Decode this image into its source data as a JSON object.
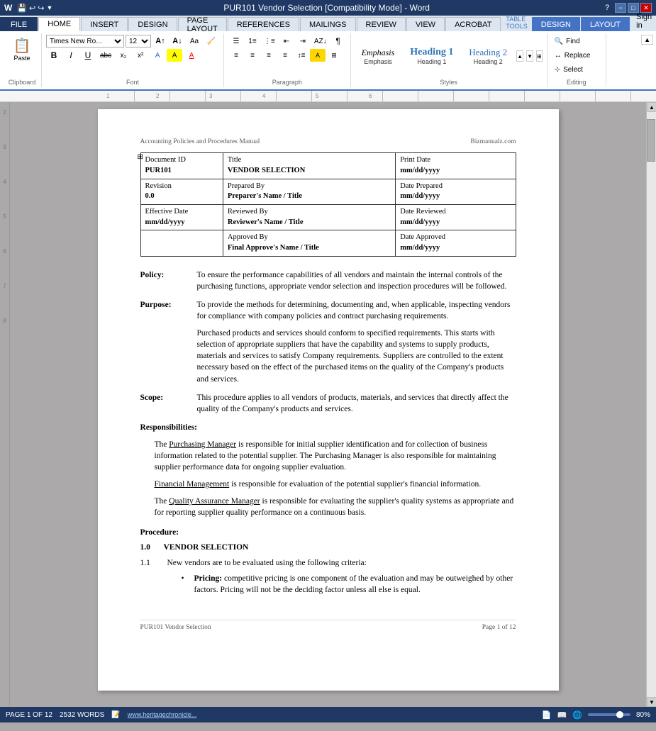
{
  "titleBar": {
    "title": "PUR101 Vendor Selection [Compatibility Mode] - Word",
    "tableTools": "TABLE TOOLS",
    "help": "?",
    "minimize": "−",
    "maximize": "□",
    "close": "✕"
  },
  "tabs": {
    "file": "FILE",
    "home": "HOME",
    "insert": "INSERT",
    "design": "DESIGN",
    "pageLayout": "PAGE LAYOUT",
    "references": "REFERENCES",
    "mailings": "MAILINGS",
    "review": "REVIEW",
    "view": "VIEW",
    "acrobat": "ACROBAT",
    "tableDesign": "DESIGN",
    "tableLayout": "LAYOUT",
    "signIn": "Sign in"
  },
  "ribbon": {
    "clipboard": {
      "label": "Clipboard",
      "paste": "Paste"
    },
    "font": {
      "label": "Font",
      "fontName": "Times New Ro...",
      "fontSize": "12",
      "bold": "B",
      "italic": "I",
      "underline": "U",
      "strikethrough": "abc",
      "subscript": "x₂",
      "superscript": "x²",
      "textColor": "A",
      "highlight": "A"
    },
    "paragraph": {
      "label": "Paragraph"
    },
    "styles": {
      "label": "Styles",
      "emphasis": "Emphasis",
      "heading1": "Heading 1",
      "heading2": "Heading 2"
    },
    "editing": {
      "label": "Editing",
      "find": "Find",
      "replace": "Replace",
      "select": "Select"
    }
  },
  "document": {
    "header": {
      "left": "Accounting Policies and Procedures Manual",
      "right": "Bizmanualz.com"
    },
    "table": {
      "rows": [
        [
          "Document ID\nPUR101",
          "Title\nVENDOR SELECTION",
          "Print Date\nmm/dd/yyyy"
        ],
        [
          "Revision\n0.0",
          "Prepared By\nPreparer's Name / Title",
          "Date Prepared\nmm/dd/yyyy"
        ],
        [
          "Effective Date\nmm/dd/yyyy",
          "Reviewed By\nReviewer's Name / Title",
          "Date Reviewed\nmm/dd/yyyy"
        ],
        [
          "",
          "Approved By\nFinal Approve's Name / Title",
          "Date Approved\nmm/dd/yyyy"
        ]
      ]
    },
    "policy": {
      "label": "Policy:",
      "text": "To ensure the performance capabilities of all vendors and maintain the internal controls of the purchasing functions, appropriate vendor selection and inspection procedures will be followed."
    },
    "purpose": {
      "label": "Purpose:",
      "text1": "To provide the methods for determining, documenting and, when applicable, inspecting vendors for compliance with company policies and contract purchasing requirements.",
      "text2": "Purchased products and services should conform to specified requirements.  This starts with selection of appropriate suppliers that have the capability and systems to supply products, materials and services to satisfy Company requirements.  Suppliers are controlled to the extent necessary based on the effect of the purchased items on the quality of the Company's products and services."
    },
    "scope": {
      "label": "Scope:",
      "text": "This procedure applies to all vendors of products, materials, and services that directly affect the quality of the Company's products and services."
    },
    "responsibilities": {
      "header": "Responsibilities:",
      "items": [
        {
          "manager": "Purchasing Manager",
          "text": " is responsible for initial supplier identification and for collection of business information related to the potential supplier. The Purchasing Manager is also responsible for maintaining supplier performance data for ongoing supplier evaluation."
        },
        {
          "manager": "Financial Management",
          "text": " is responsible for evaluation of the potential supplier's financial information."
        },
        {
          "manager": "Quality Assurance Manager",
          "text": " is responsible for evaluating the supplier's quality systems as appropriate and for reporting supplier quality performance on a continuous basis."
        }
      ]
    },
    "procedure": {
      "header": "Procedure:",
      "section1": {
        "num": "1.0",
        "title": "VENDOR SELECTION",
        "subsections": [
          {
            "num": "1.1",
            "text": "New vendors are to be evaluated using the following criteria:",
            "bullets": [
              {
                "label": "Pricing:",
                "text": " competitive pricing is one component of the evaluation and may be outweighed by other factors.  Pricing will not be the deciding factor unless all else is equal."
              }
            ]
          }
        ]
      }
    },
    "footer": {
      "left": "PUR101 Vendor Selection",
      "right": "Page 1 of 12"
    }
  },
  "statusBar": {
    "page": "PAGE 1 OF 12",
    "words": "2532 WORDS",
    "trackChanges": "📝",
    "zoom": "80%",
    "link": "www.heritagechronicle..."
  }
}
